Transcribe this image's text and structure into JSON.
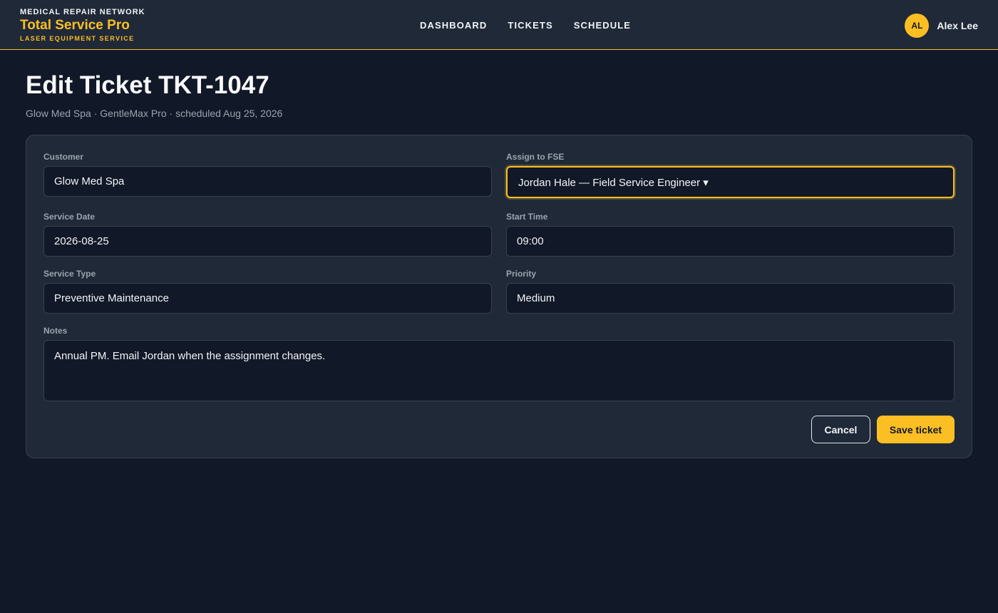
{
  "header": {
    "network": "MEDICAL REPAIR NETWORK",
    "brand": "Total Service Pro",
    "tagline": "LASER EQUIPMENT SERVICE",
    "nav": [
      {
        "label": "DASHBOARD"
      },
      {
        "label": "TICKETS"
      },
      {
        "label": "SCHEDULE"
      }
    ],
    "user": {
      "initials": "AL",
      "name": "Alex Lee"
    }
  },
  "page": {
    "title": "Edit Ticket TKT-1047",
    "subtitle": "Glow Med Spa · GentleMax Pro · scheduled Aug 25, 2026"
  },
  "form": {
    "customer": {
      "label": "Customer",
      "value": "Glow Med Spa"
    },
    "assign": {
      "label": "Assign to FSE",
      "value": "Jordan Hale — Field Service Engineer ▾"
    },
    "service_date": {
      "label": "Service Date",
      "value": "2026-08-25"
    },
    "start_time": {
      "label": "Start Time",
      "value": "09:00"
    },
    "service_type": {
      "label": "Service Type",
      "value": "Preventive Maintenance"
    },
    "priority": {
      "label": "Priority",
      "value": "Medium"
    },
    "notes": {
      "label": "Notes",
      "value": "Annual PM. Email Jordan when the assignment changes."
    },
    "cancel_label": "Cancel",
    "save_label": "Save ticket"
  },
  "colors": {
    "background": "#111827",
    "surface": "#1f2937",
    "accent": "#fbbf24"
  }
}
